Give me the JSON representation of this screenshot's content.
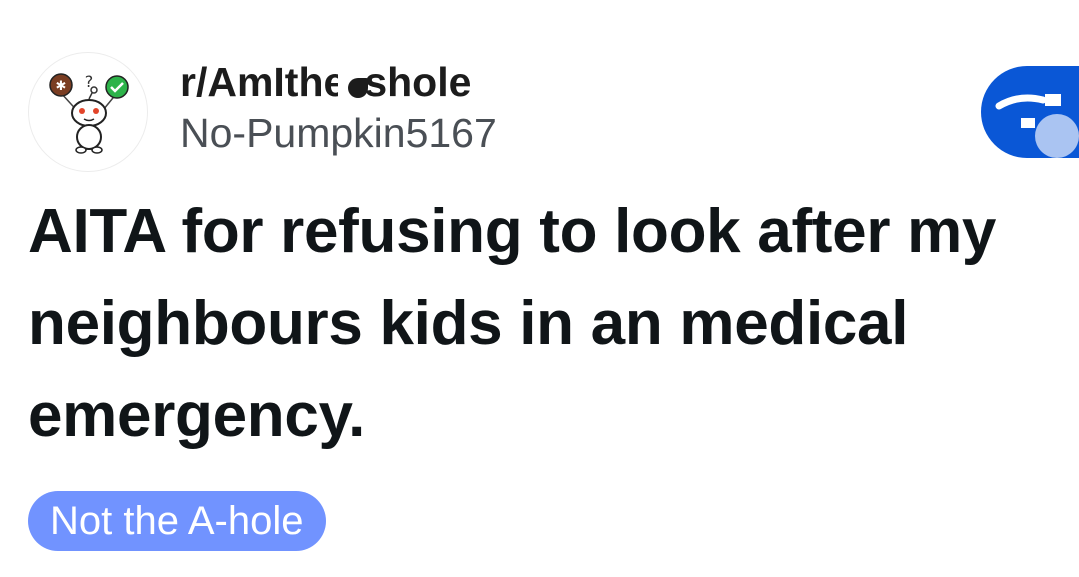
{
  "post": {
    "subreddit_prefix": "r/AmIthe",
    "subreddit_suffix": "shole",
    "username": "No-Pumpkin5167",
    "title": "AITA for refusing to look after my neighbours kids in an medical emergency.",
    "flair": "Not the A-hole"
  },
  "icons": {
    "avatar": "snoo-avatar-icon",
    "join": "join-button-icon"
  },
  "colors": {
    "flair_bg": "#7193ff",
    "join_bg": "#0a57d6",
    "title_text": "#101518"
  }
}
